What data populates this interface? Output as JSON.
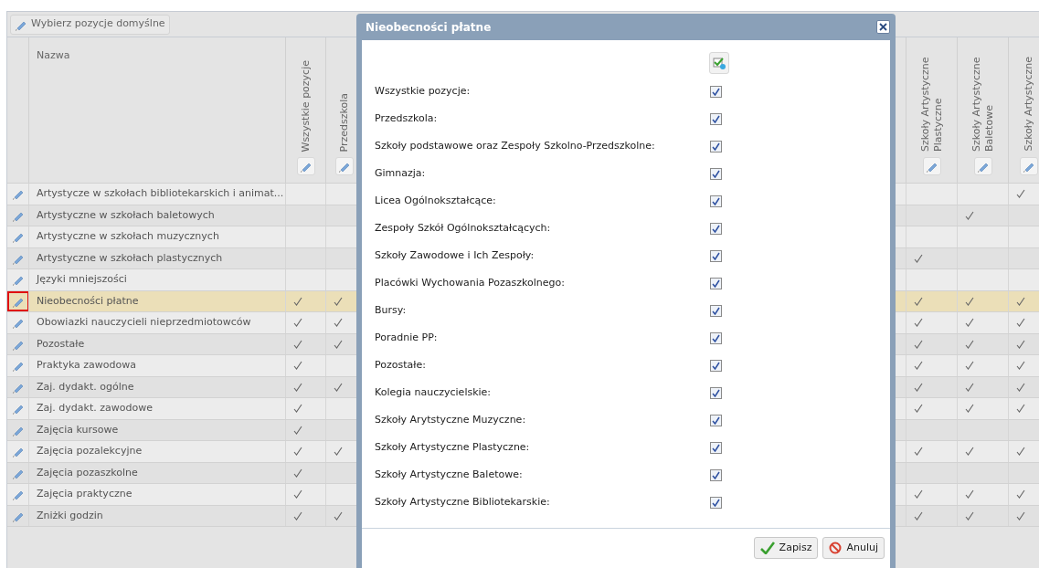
{
  "toolbar": {
    "button": "Wybierz pozycje domyślne"
  },
  "table": {
    "columns": [
      {
        "label": "Nazwa"
      },
      {
        "label": "Wszystkie pozycje"
      },
      {
        "label": "Przedszkola"
      },
      {
        "label": "Szkoły Artystyczne Plastyczne"
      },
      {
        "label": "Szkoły Artystyczne Baletowe"
      },
      {
        "label": "Szkoły Artystyczne"
      }
    ],
    "rows": [
      {
        "name": "Artystycze w szkołach bibliotekarskich i animat...",
        "selected": false,
        "marked": false,
        "checks": [
          false,
          false,
          false,
          false,
          true
        ]
      },
      {
        "name": "Artystyczne w szkołach baletowych",
        "selected": false,
        "marked": false,
        "checks": [
          false,
          false,
          false,
          true,
          false
        ]
      },
      {
        "name": "Artystyczne w szkołach muzycznych",
        "selected": false,
        "marked": false,
        "checks": [
          false,
          false,
          false,
          false,
          false
        ]
      },
      {
        "name": "Artystyczne w szkołach plastycznych",
        "selected": false,
        "marked": false,
        "checks": [
          false,
          false,
          true,
          false,
          false
        ]
      },
      {
        "name": "Języki mniejszości",
        "selected": false,
        "marked": false,
        "checks": [
          false,
          false,
          false,
          false,
          false
        ]
      },
      {
        "name": "Nieobecności płatne",
        "selected": true,
        "marked": true,
        "checks": [
          true,
          true,
          true,
          true,
          true
        ]
      },
      {
        "name": "Obowiazki nauczycieli nieprzedmiotowców",
        "selected": false,
        "marked": false,
        "checks": [
          true,
          true,
          true,
          true,
          true
        ]
      },
      {
        "name": "Pozostałe",
        "selected": false,
        "marked": false,
        "checks": [
          true,
          true,
          true,
          true,
          true
        ]
      },
      {
        "name": "Praktyka zawodowa",
        "selected": false,
        "marked": false,
        "checks": [
          true,
          false,
          true,
          true,
          true
        ]
      },
      {
        "name": "Zaj. dydakt. ogólne",
        "selected": false,
        "marked": false,
        "checks": [
          true,
          true,
          true,
          true,
          true
        ]
      },
      {
        "name": "Zaj. dydakt. zawodowe",
        "selected": false,
        "marked": false,
        "checks": [
          true,
          false,
          true,
          true,
          true
        ]
      },
      {
        "name": "Zajęcia kursowe",
        "selected": false,
        "marked": false,
        "checks": [
          true,
          false,
          false,
          false,
          false
        ]
      },
      {
        "name": "Zajęcia pozalekcyjne",
        "selected": false,
        "marked": false,
        "checks": [
          true,
          true,
          true,
          true,
          true
        ]
      },
      {
        "name": "Zajęcia pozaszkolne",
        "selected": false,
        "marked": false,
        "checks": [
          true,
          false,
          false,
          false,
          false
        ]
      },
      {
        "name": "Zajęcia praktyczne",
        "selected": false,
        "marked": false,
        "checks": [
          true,
          false,
          true,
          true,
          true
        ]
      },
      {
        "name": "Zniżki godzin",
        "selected": false,
        "marked": false,
        "checks": [
          true,
          true,
          true,
          true,
          true
        ]
      }
    ]
  },
  "dialog": {
    "title": "Nieobecności płatne",
    "items": [
      {
        "label": "Wszystkie pozycje:",
        "checked": true
      },
      {
        "label": "Przedszkola:",
        "checked": true
      },
      {
        "label": "Szkoły podstawowe oraz Zespoły Szkolno-Przedszkolne:",
        "checked": true
      },
      {
        "label": "Gimnazja:",
        "checked": true
      },
      {
        "label": "Licea Ogólnokształcące:",
        "checked": true
      },
      {
        "label": "Zespoły Szkół Ogólnokształcących:",
        "checked": true
      },
      {
        "label": "Szkoły Zawodowe i Ich Zespoły:",
        "checked": true
      },
      {
        "label": "Placówki Wychowania Pozaszkolnego:",
        "checked": true
      },
      {
        "label": "Bursy:",
        "checked": true
      },
      {
        "label": "Poradnie PP:",
        "checked": true
      },
      {
        "label": "Pozostałe:",
        "checked": true
      },
      {
        "label": "Kolegia nauczycielskie:",
        "checked": true
      },
      {
        "label": "Szkoły Arytstyczne Muzyczne:",
        "checked": true
      },
      {
        "label": "Szkoły Artystyczne Plastyczne:",
        "checked": true
      },
      {
        "label": "Szkoły Artystyczne Baletowe:",
        "checked": true
      },
      {
        "label": "Szkoły Artystyczne Bibliotekarskie:",
        "checked": true
      }
    ],
    "buttons": [
      {
        "label": "Zapisz",
        "kind": "save"
      },
      {
        "label": "Anuluj",
        "kind": "cancel"
      }
    ]
  }
}
